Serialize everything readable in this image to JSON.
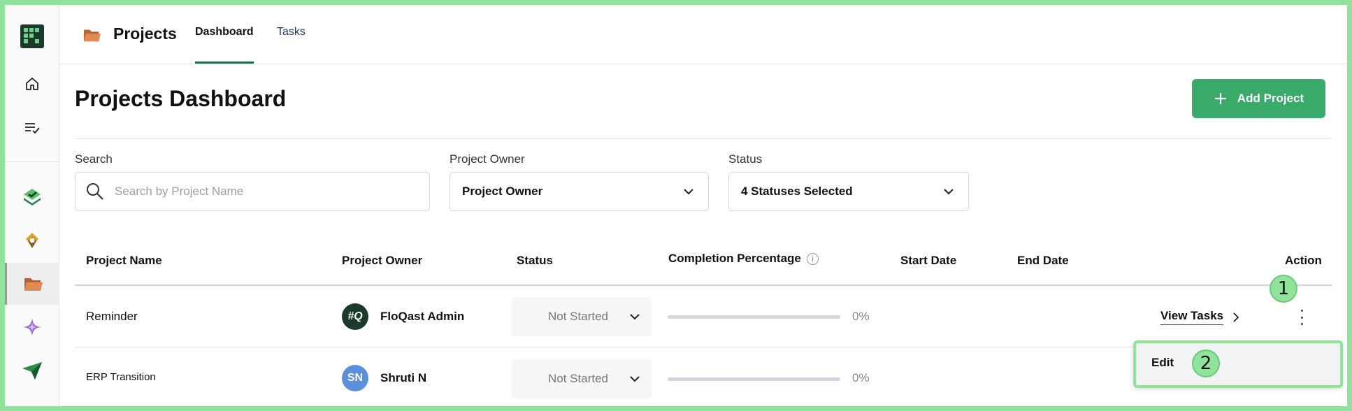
{
  "topbar": {
    "title": "Projects",
    "tabs": [
      {
        "label": "Dashboard",
        "active": true
      },
      {
        "label": "Tasks",
        "active": false
      }
    ]
  },
  "page": {
    "title": "Projects Dashboard",
    "add_button_label": "Add Project"
  },
  "filters": {
    "search_label": "Search",
    "search_placeholder": "Search by Project Name",
    "owner_label": "Project Owner",
    "owner_value": "Project Owner",
    "status_label": "Status",
    "status_value": "4 Statuses Selected"
  },
  "table": {
    "columns": [
      "Project Name",
      "Project Owner",
      "Status",
      "Completion Percentage",
      "Start Date",
      "End Date",
      "Action"
    ],
    "rows": [
      {
        "name": "Reminder",
        "owner_initials": "#Q",
        "owner": "FloQast Admin",
        "status": "Not Started",
        "completion": 0,
        "completion_label": "0%",
        "start_date": "",
        "end_date": "",
        "action": "View Tasks"
      },
      {
        "name": "ERP Transition",
        "owner_initials": "SN",
        "owner": "Shruti N",
        "status": "Not Started",
        "completion": 0,
        "completion_label": "0%",
        "start_date": "",
        "end_date": ""
      }
    ]
  },
  "menu": {
    "items": [
      {
        "label": "Edit"
      }
    ]
  },
  "markers": [
    "1",
    "2"
  ],
  "colors": {
    "accent": "#3aaa6b",
    "tab_underline": "#1f6b4f",
    "highlight": "#8fe39a",
    "avatar_admin": "#1b3a2b",
    "avatar_user": "#5b8fd9"
  }
}
